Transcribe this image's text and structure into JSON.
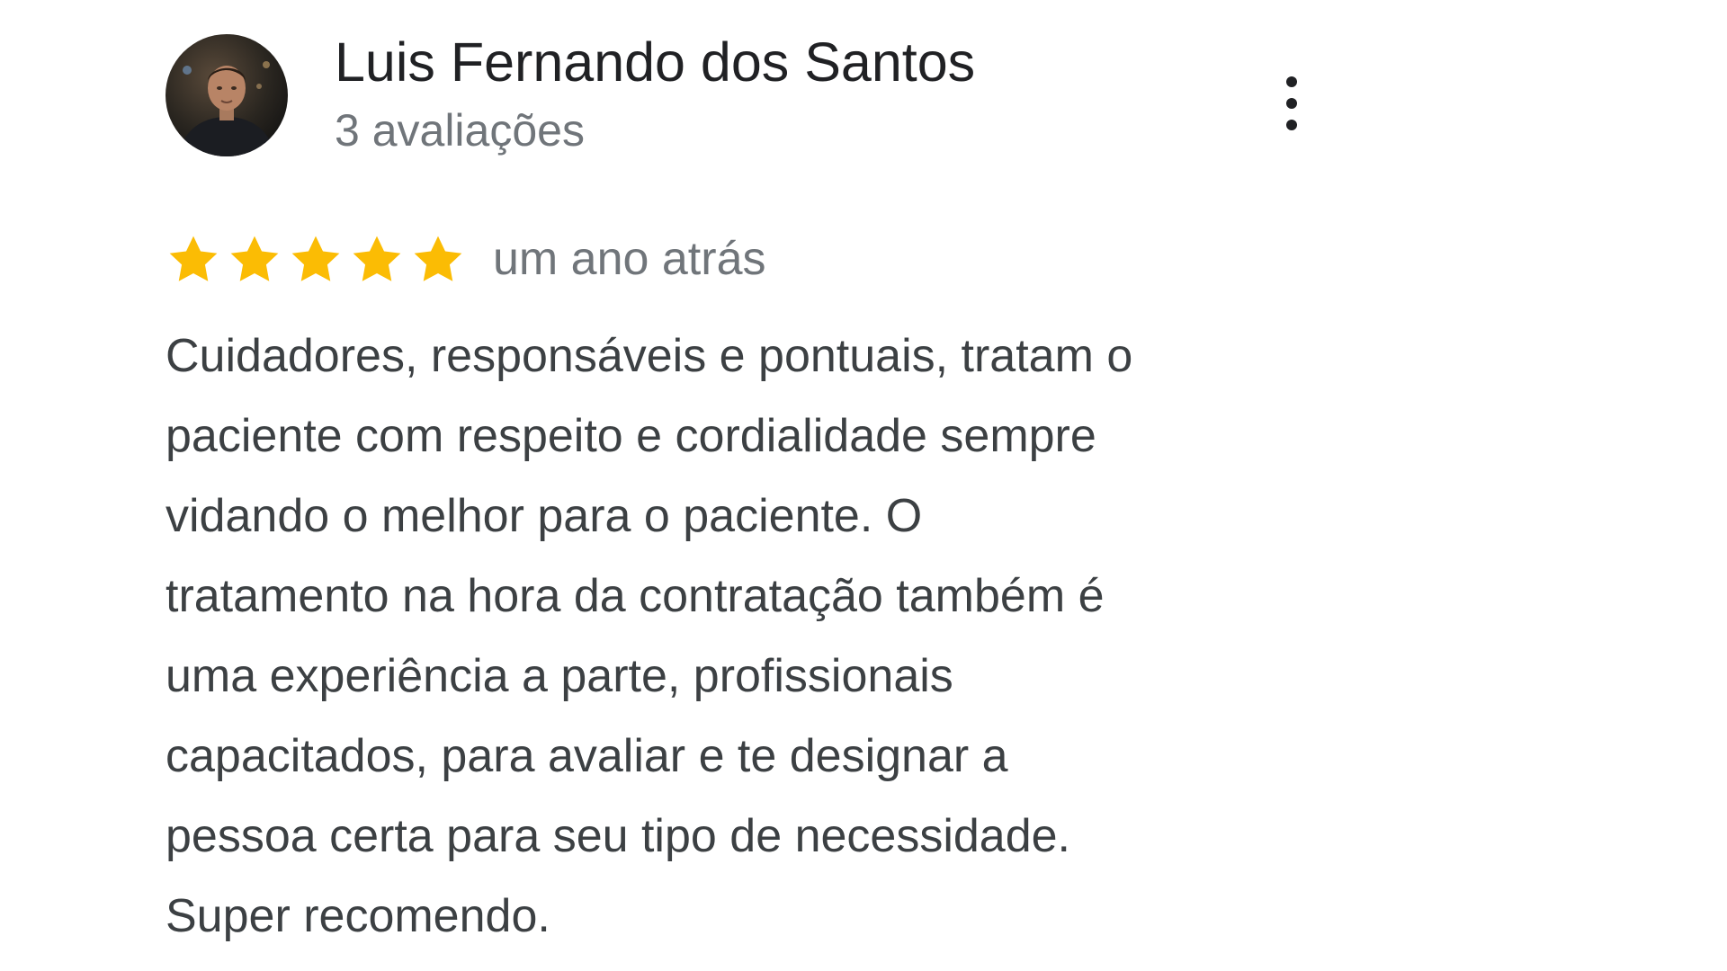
{
  "review": {
    "reviewer_name": "Luis Fernando dos Santos",
    "review_count": "3 avaliações",
    "rating": 5,
    "rating_max": 5,
    "date": "um ano atrás",
    "text_lines": [
      "Cuidadores, responsáveis e pontuais, tratam o",
      "paciente com respeito e cordialidade sempre",
      "vidando o melhor para o paciente. O",
      "tratamento na hora da contratação também é",
      "uma experiência a parte, profissionais",
      "capacitados, para avaliar e te designar a",
      "pessoa certa para seu tipo de necessidade.",
      "Super recomendo."
    ]
  },
  "icons": {
    "avatar": "reviewer-photo",
    "menu": "more-vert-icon",
    "star": "star-icon"
  },
  "colors": {
    "name": "#202124",
    "meta": "#70757a",
    "body": "#3c4043",
    "star": "#fbbc04"
  }
}
